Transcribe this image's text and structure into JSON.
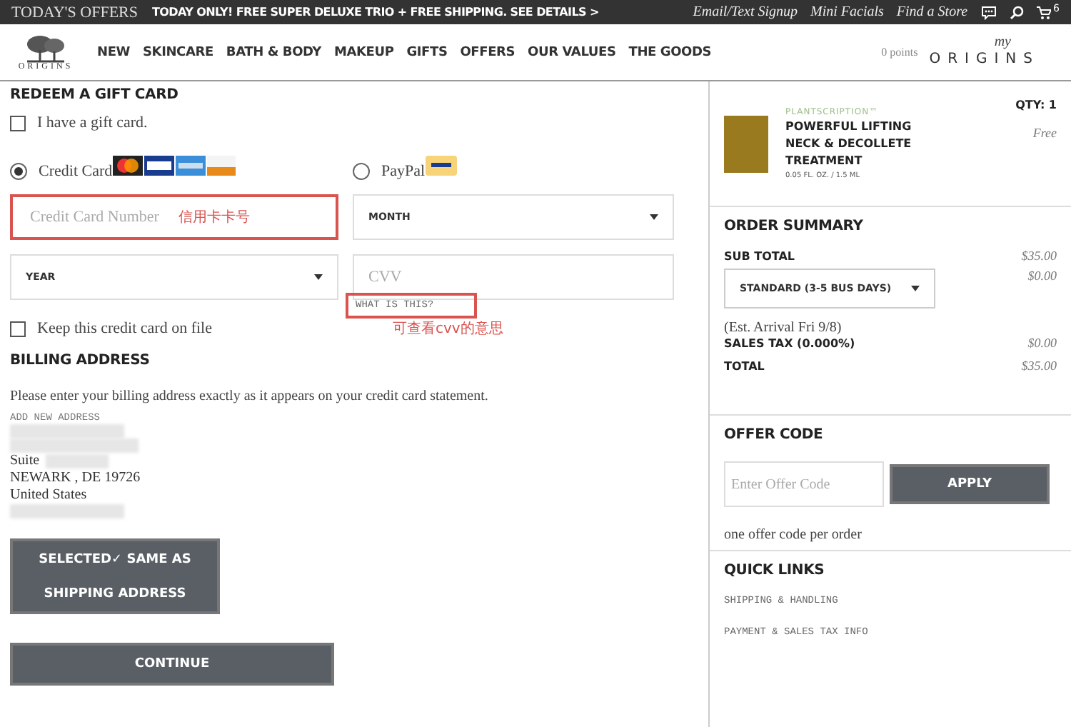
{
  "top_bar": {
    "offers_label": "TODAY'S OFFERS",
    "promo": "TODAY ONLY! FREE SUPER DELUXE TRIO + FREE SHIPPING. SEE DETAILS >",
    "links": [
      "Email/Text Signup",
      "Mini Facials",
      "Find a Store"
    ],
    "cart_count": "6"
  },
  "nav": {
    "logo_text": "ORIGINS",
    "items": [
      "NEW",
      "SKINCARE",
      "BATH & BODY",
      "MAKEUP",
      "GIFTS",
      "OFFERS",
      "OUR VALUES",
      "THE GOODS"
    ],
    "points": "0 points",
    "account_logo": {
      "script": "my",
      "word": "ORIGINS"
    }
  },
  "gift_card": {
    "heading": "REDEEM A GIFT CARD",
    "label": "I have a gift card.",
    "checked": false
  },
  "payment": {
    "methods": [
      {
        "kind": "card",
        "label": "Credit Card",
        "selected": true
      },
      {
        "kind": "paypal",
        "label": "PayPal",
        "selected": false
      }
    ],
    "card_number": {
      "placeholder": "Credit Card Number",
      "note": "信用卡卡号"
    },
    "month": {
      "value": "MONTH"
    },
    "year": {
      "value": "YEAR"
    },
    "cvv": {
      "placeholder": "CVV"
    },
    "cvv_help": {
      "label": "WHAT IS THIS?",
      "note": "可查看cvv的意思"
    },
    "keep_card": {
      "label": "Keep this credit card on file",
      "checked": false
    }
  },
  "billing": {
    "heading": "BILLING ADDRESS",
    "instructions": "Please enter your billing address exactly as it appears on your credit card statement.",
    "add_new_label": "ADD NEW ADDRESS",
    "address_lines": [
      {
        "kind": "redacted"
      },
      {
        "kind": "redacted"
      },
      {
        "kind": "partial",
        "text": "Suite"
      },
      {
        "kind": "text",
        "text": "NEWARK , DE 19726"
      },
      {
        "kind": "text",
        "text": "United States"
      },
      {
        "kind": "redacted"
      }
    ],
    "same_as_shipping": {
      "label": "SELECTED✓ SAME AS SHIPPING ADDRESS",
      "selected": true
    },
    "continue_label": "CONTINUE"
  },
  "cart_item": {
    "brand": "PLANTSCRIPTION™",
    "name": "POWERFUL LIFTING NECK & DECOLLETE TREATMENT",
    "size": "0.05 FL. OZ. / 1.5 ML",
    "qty": "QTY: 1",
    "price": "Free"
  },
  "order_summary": {
    "heading": "ORDER SUMMARY",
    "rows": [
      {
        "kind": "line",
        "label": "SUB TOTAL",
        "value": "$35.00"
      },
      {
        "kind": "select",
        "label": "STANDARD (3-5 BUS DAYS)",
        "value": "$0.00"
      },
      {
        "kind": "note",
        "label": "(Est. Arrival Fri 9/8)"
      },
      {
        "kind": "line",
        "label": "SALES TAX (0.000%)",
        "value": "$0.00"
      },
      {
        "kind": "total",
        "label": "TOTAL",
        "value": "$35.00"
      }
    ]
  },
  "offer_code": {
    "heading": "OFFER CODE",
    "placeholder": "Enter Offer Code",
    "button": "APPLY",
    "note": "one offer code per order"
  },
  "quick_links": {
    "heading": "QUICK LINKS",
    "links": [
      "SHIPPING & HANDLING",
      "PAYMENT & SALES TAX INFO"
    ]
  }
}
